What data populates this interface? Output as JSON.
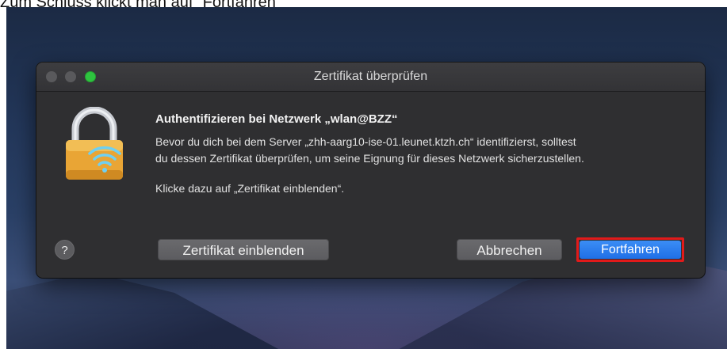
{
  "caption": "Zum Schluss klickt man auf “Fortfahren”",
  "dialog": {
    "title": "Zertifikat überprüfen",
    "heading": "Authentifizieren bei Netzwerk „wlan@BZZ“",
    "paragraph_line1": "Bevor du dich bei dem Server „zhh-aarg10-ise-01.leunet.ktzh.ch“ identifizierst, solltest",
    "paragraph_line2": "du dessen Zertifikat überprüfen, um seine Eignung für dieses Netzwerk sicherzustellen.",
    "paragraph_hint": "Klicke dazu auf „Zertifikat einblenden“.",
    "help_label": "?",
    "buttons": {
      "show_certificate": "Zertifikat einblenden",
      "cancel": "Abbrechen",
      "continue": "Fortfahren"
    },
    "icon": "wifi-lock-icon"
  },
  "colors": {
    "highlight": "#e11a1a",
    "primary_button": "#1f6fe6",
    "dialog_bg": "#2f2f31"
  }
}
